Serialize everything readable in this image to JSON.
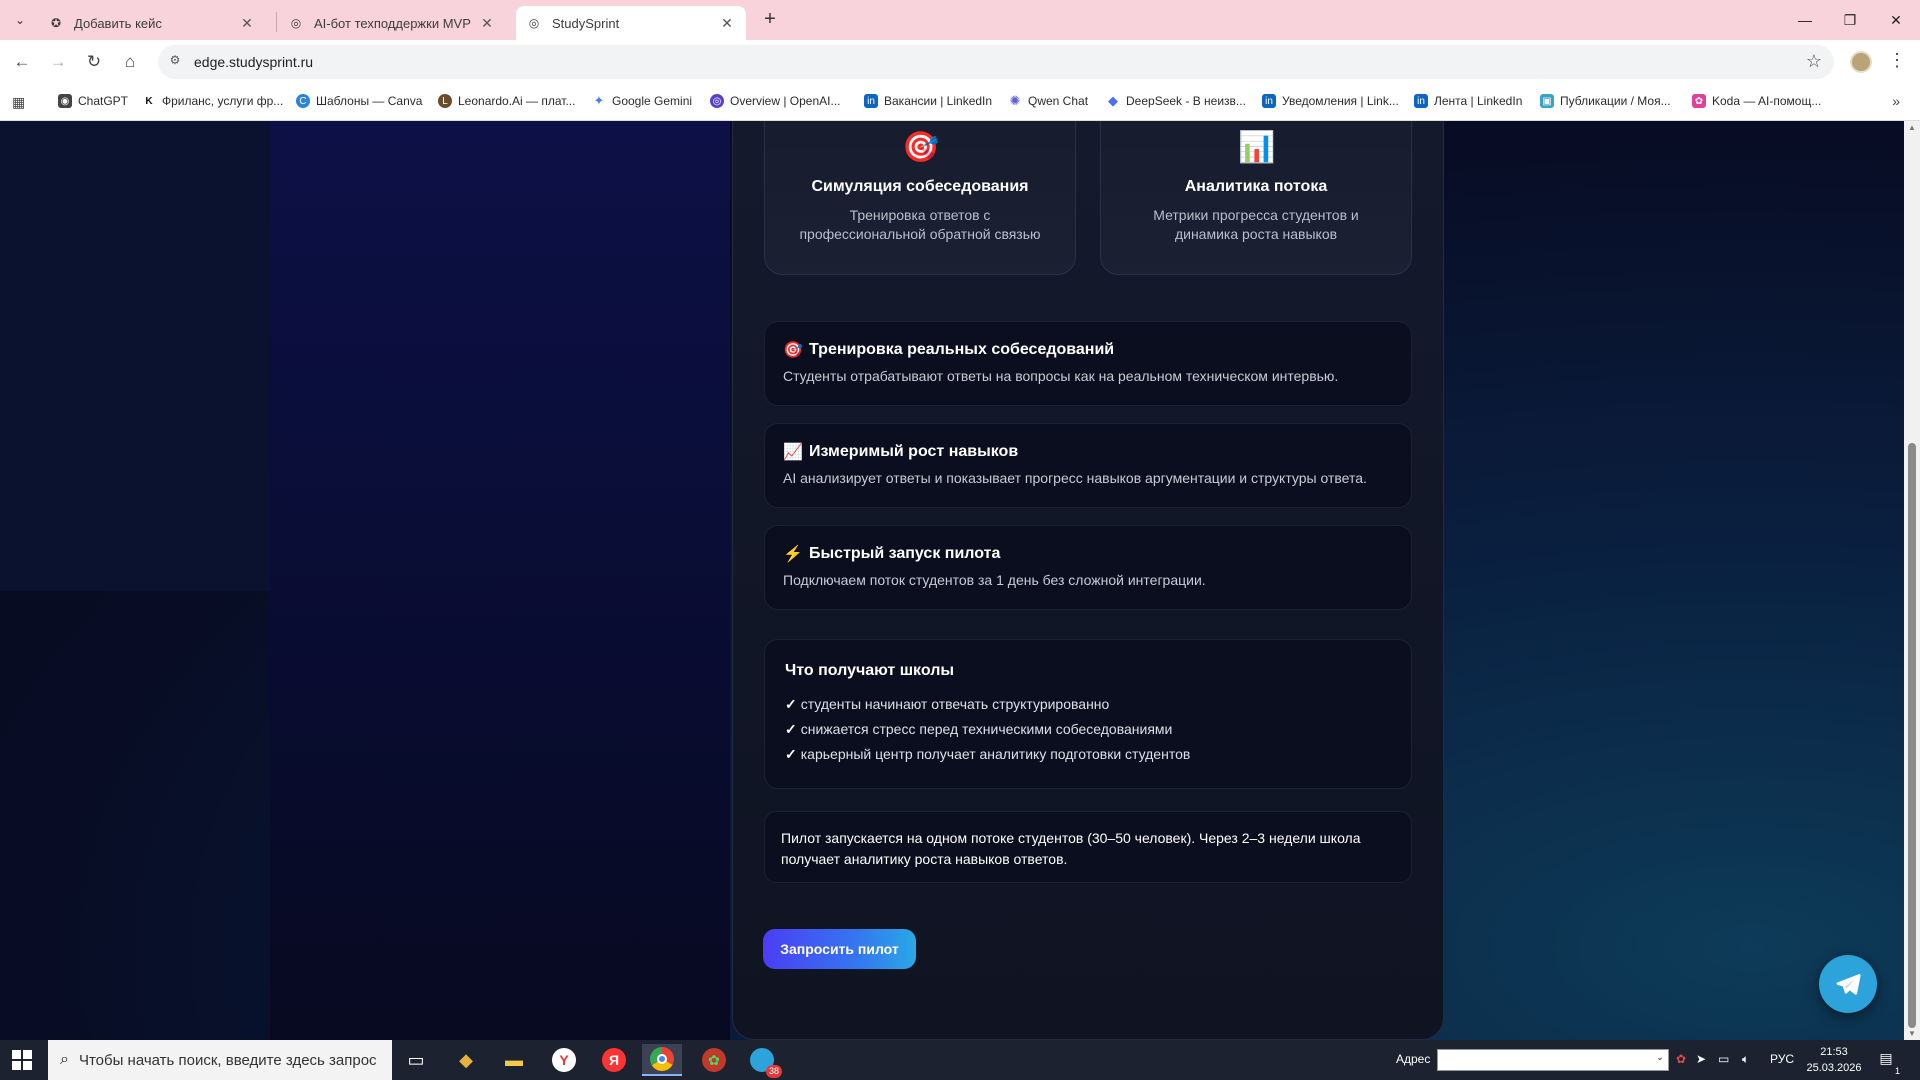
{
  "browser": {
    "tabs": [
      {
        "title": "Добавить кейс",
        "icon": "star-badge-icon"
      },
      {
        "title": "AI-бот техподдержки MVP",
        "icon": "globe-icon"
      },
      {
        "title": "StudySprint",
        "icon": "globe-icon",
        "active": true
      }
    ],
    "url": "edge.studysprint.ru",
    "bookmarks": [
      {
        "label": "ChatGPT",
        "icon": "openai-icon",
        "color": "#444444"
      },
      {
        "label": "Фриланс, услуги фр...",
        "icon": "kwork-icon",
        "color": "#222222"
      },
      {
        "label": "Шаблоны — Canva",
        "icon": "canva-icon",
        "color": "#2b86d9"
      },
      {
        "label": "Leonardo.Ai — плат...",
        "icon": "leonardo-icon",
        "color": "#6b4b2e"
      },
      {
        "label": "Google Gemini",
        "icon": "gemini-icon",
        "color": "#4f7ee8"
      },
      {
        "label": "Overview | OpenAI...",
        "icon": "openai-circle-icon",
        "color": "#5b3fd1"
      },
      {
        "label": "Вакансии | LinkedIn",
        "icon": "linkedin-icon",
        "color": "#0a66c2"
      },
      {
        "label": "Qwen Chat",
        "icon": "qwen-icon",
        "color": "#5b5cd6"
      },
      {
        "label": "DeepSeek - В неизв...",
        "icon": "deepseek-icon",
        "color": "#4d6bfe"
      },
      {
        "label": "Уведомления | Link...",
        "icon": "linkedin-icon",
        "color": "#0a66c2"
      },
      {
        "label": "Лента | LinkedIn",
        "icon": "linkedin-icon",
        "color": "#0a66c2"
      },
      {
        "label": "Публикации / Моя...",
        "icon": "publications-icon",
        "color": "#3aa3c9"
      },
      {
        "label": "Koda — AI-помощ...",
        "icon": "koda-icon",
        "color": "#e0409a"
      }
    ]
  },
  "features": [
    {
      "icon": "🎯",
      "title": "Симуляция собеседования",
      "desc": "Тренировка ответов с профессиональной обратной связью"
    },
    {
      "icon": "📊",
      "title": "Аналитика потока",
      "desc": "Метрики прогресса студентов и динамика роста навыков"
    }
  ],
  "benefits": [
    {
      "icon": "🎯",
      "title": "Тренировка реальных собеседований",
      "desc": "Студенты отрабатывают ответы на вопросы как на реальном техническом интервью."
    },
    {
      "icon": "📈",
      "title": "Измеримый рост навыков",
      "desc": "AI анализирует ответы и показывает прогресс навыков аргументации и структуры ответа."
    },
    {
      "icon": "⚡",
      "title": "Быстрый запуск пилота",
      "desc": "Подключаем поток студентов за 1 день без сложной интеграции."
    }
  ],
  "schools": {
    "title": "Что получают школы",
    "check": "✓",
    "items": [
      "студенты начинают отвечать структурированно",
      "снижается стресс перед техническими собеседованиями",
      "карьерный центр получает аналитику подготовки студентов"
    ]
  },
  "note": "Пилот запускается на одном потоке студентов (30–50 человек). Через 2–3 недели школа получает аналитику роста навыков ответов.",
  "cta": "Запросить пилот",
  "colors": {
    "accent_start": "#4b3ef5",
    "accent_end": "#2aa8e6",
    "telegram": "#2da3dc",
    "tabstrip": "#f9d3dc"
  },
  "taskbar": {
    "search_placeholder": "Чтобы начать поиск, введите здесь запрос",
    "address_label": "Адрес",
    "lang": "РУС",
    "time": "21:53",
    "date": "25.03.2026",
    "telegram_badge": "38",
    "notif_count": "1"
  }
}
